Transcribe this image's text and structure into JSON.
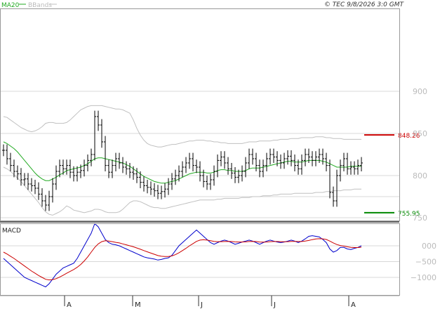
{
  "header": {
    "ma_label": "MA20",
    "bb_label": "BBands",
    "copyright": "© TEC 9/8/2026 3:0 GMT"
  },
  "colors": {
    "price": "#000000",
    "ma": "#22aa22",
    "bbands": "#c0c0c0",
    "macd": "#0000cc",
    "signal": "#cc0000",
    "resistance": "#cc0000",
    "support": "#008800",
    "grid": "#d8d8d8",
    "axis": "#999999"
  },
  "chart_data": [
    {
      "type": "ohlc",
      "name": "price",
      "ylim": [
        700,
        920
      ],
      "y_ticks": [
        750,
        800,
        850,
        900
      ],
      "y_tick_labels": [
        "750",
        "800",
        "850",
        "900"
      ],
      "x_ticks": [
        "A",
        "M",
        "J",
        "J",
        "A"
      ],
      "grid": true,
      "levels": [
        {
          "label": "848.26",
          "value": 848.26,
          "kind": "resistance"
        },
        {
          "label": "755.95",
          "value": 755.95,
          "kind": "support"
        }
      ],
      "close": [
        830,
        820,
        812,
        805,
        802,
        795,
        796,
        790,
        788,
        785,
        778,
        770,
        765,
        775,
        790,
        805,
        812,
        808,
        812,
        804,
        800,
        804,
        806,
        812,
        818,
        825,
        870,
        860,
        840,
        812,
        804,
        812,
        820,
        815,
        810,
        808,
        804,
        802,
        798,
        792,
        788,
        786,
        784,
        782,
        779,
        781,
        784,
        790,
        796,
        800,
        805,
        810,
        815,
        820,
        812,
        810,
        800,
        793,
        790,
        795,
        805,
        818,
        822,
        815,
        808,
        803,
        798,
        800,
        805,
        815,
        825,
        820,
        812,
        805,
        812,
        820,
        825,
        822,
        818,
        815,
        820,
        823,
        818,
        812,
        808,
        818,
        825,
        822,
        818,
        822,
        825,
        820,
        812,
        780,
        770,
        800,
        812,
        820,
        808,
        810,
        808,
        812,
        815
      ],
      "ma20": [
        840,
        838,
        835,
        832,
        828,
        823,
        818,
        813,
        808,
        803,
        799,
        796,
        794,
        794,
        796,
        798,
        801,
        803,
        806,
        807,
        808,
        809,
        810,
        812,
        814,
        817,
        820,
        821,
        821,
        820,
        819,
        818,
        817,
        816,
        815,
        813,
        811,
        808,
        805,
        802,
        799,
        797,
        795,
        793,
        792,
        791,
        791,
        792,
        793,
        794,
        796,
        798,
        800,
        802,
        803,
        804,
        804,
        804,
        803,
        803,
        804,
        806,
        807,
        807,
        806,
        806,
        805,
        805,
        805,
        806,
        808,
        809,
        809,
        809,
        810,
        811,
        812,
        813,
        814,
        815,
        816,
        817,
        817,
        816,
        816,
        816,
        817,
        818,
        818,
        818,
        818,
        817,
        816,
        814,
        812,
        810,
        810,
        810,
        810,
        811,
        811,
        811,
        811
      ],
      "bb_upper": [
        870,
        869,
        866,
        863,
        860,
        857,
        855,
        853,
        852,
        853,
        855,
        858,
        862,
        863,
        863,
        862,
        862,
        862,
        863,
        866,
        870,
        874,
        878,
        880,
        882,
        883,
        883,
        883,
        883,
        882,
        881,
        880,
        879,
        879,
        878,
        876,
        874,
        866,
        856,
        848,
        842,
        838,
        836,
        835,
        834,
        834,
        835,
        836,
        837,
        837,
        838,
        839,
        840,
        841,
        841,
        842,
        842,
        842,
        841,
        841,
        840,
        840,
        839,
        839,
        838,
        838,
        838,
        838,
        838,
        839,
        840,
        840,
        840,
        841,
        841,
        841,
        841,
        842,
        842,
        843,
        843,
        843,
        844,
        844,
        844,
        845,
        845,
        845,
        845,
        846,
        846,
        846,
        845,
        845,
        844,
        844,
        844,
        843,
        843,
        843,
        843,
        843,
        843
      ],
      "bb_lower": [
        810,
        808,
        805,
        801,
        797,
        793,
        788,
        783,
        778,
        773,
        768,
        762,
        757,
        754,
        753,
        755,
        757,
        760,
        764,
        762,
        759,
        758,
        757,
        756,
        757,
        758,
        760,
        760,
        759,
        757,
        756,
        756,
        756,
        757,
        760,
        764,
        768,
        770,
        770,
        769,
        767,
        765,
        763,
        762,
        762,
        761,
        761,
        762,
        763,
        764,
        765,
        766,
        767,
        768,
        769,
        770,
        771,
        771,
        771,
        771,
        771,
        772,
        772,
        773,
        773,
        773,
        773,
        773,
        774,
        774,
        774,
        775,
        775,
        775,
        776,
        776,
        776,
        777,
        777,
        778,
        778,
        778,
        778,
        779,
        779,
        779,
        779,
        779,
        779,
        780,
        780,
        780,
        781,
        781,
        782,
        782,
        782,
        783,
        783,
        783,
        784,
        784,
        784
      ]
    },
    {
      "type": "line",
      "name": "MACD",
      "title": "MACD",
      "ylim": [
        -1600,
        900
      ],
      "y_ticks": [
        0,
        -500,
        -1000
      ],
      "y_tick_labels": [
        "000",
        "−500",
        "−1000"
      ],
      "grid": true,
      "series": [
        {
          "name": "macd",
          "values": [
            -400,
            -500,
            -600,
            -700,
            -800,
            -900,
            -1000,
            -1050,
            -1100,
            -1150,
            -1200,
            -1250,
            -1300,
            -1200,
            -1050,
            -900,
            -800,
            -700,
            -650,
            -600,
            -550,
            -400,
            -200,
            0,
            200,
            400,
            700,
            600,
            400,
            200,
            100,
            50,
            30,
            0,
            -50,
            -100,
            -150,
            -200,
            -250,
            -300,
            -350,
            -380,
            -400,
            -420,
            -450,
            -430,
            -400,
            -380,
            -300,
            -150,
            0,
            100,
            200,
            300,
            400,
            500,
            400,
            300,
            200,
            100,
            50,
            100,
            150,
            180,
            150,
            100,
            50,
            80,
            120,
            150,
            180,
            150,
            100,
            50,
            100,
            150,
            180,
            150,
            120,
            100,
            120,
            150,
            180,
            150,
            100,
            150,
            220,
            300,
            320,
            300,
            280,
            200,
            100,
            -100,
            -200,
            -150,
            -50,
            -50,
            -100,
            -120,
            -80,
            -50,
            0
          ]
        },
        {
          "name": "signal",
          "values": [
            -200,
            -260,
            -330,
            -400,
            -480,
            -560,
            -640,
            -720,
            -800,
            -870,
            -940,
            -1000,
            -1060,
            -1080,
            -1070,
            -1040,
            -990,
            -930,
            -870,
            -810,
            -750,
            -680,
            -590,
            -480,
            -350,
            -200,
            -50,
            60,
            130,
            160,
            150,
            130,
            110,
            90,
            60,
            30,
            0,
            -30,
            -70,
            -110,
            -150,
            -190,
            -230,
            -270,
            -310,
            -330,
            -340,
            -340,
            -320,
            -280,
            -220,
            -150,
            -80,
            0,
            70,
            140,
            180,
            190,
            180,
            160,
            140,
            130,
            130,
            135,
            138,
            135,
            125,
            120,
            120,
            125,
            135,
            140,
            135,
            120,
            115,
            120,
            130,
            135,
            135,
            130,
            128,
            130,
            138,
            140,
            135,
            135,
            150,
            170,
            195,
            215,
            225,
            220,
            200,
            150,
            90,
            40,
            10,
            -10,
            -30,
            -50,
            -55,
            -55,
            -45
          ]
        }
      ],
      "x_ticks": [
        "A",
        "M",
        "J",
        "J",
        "A"
      ]
    }
  ]
}
